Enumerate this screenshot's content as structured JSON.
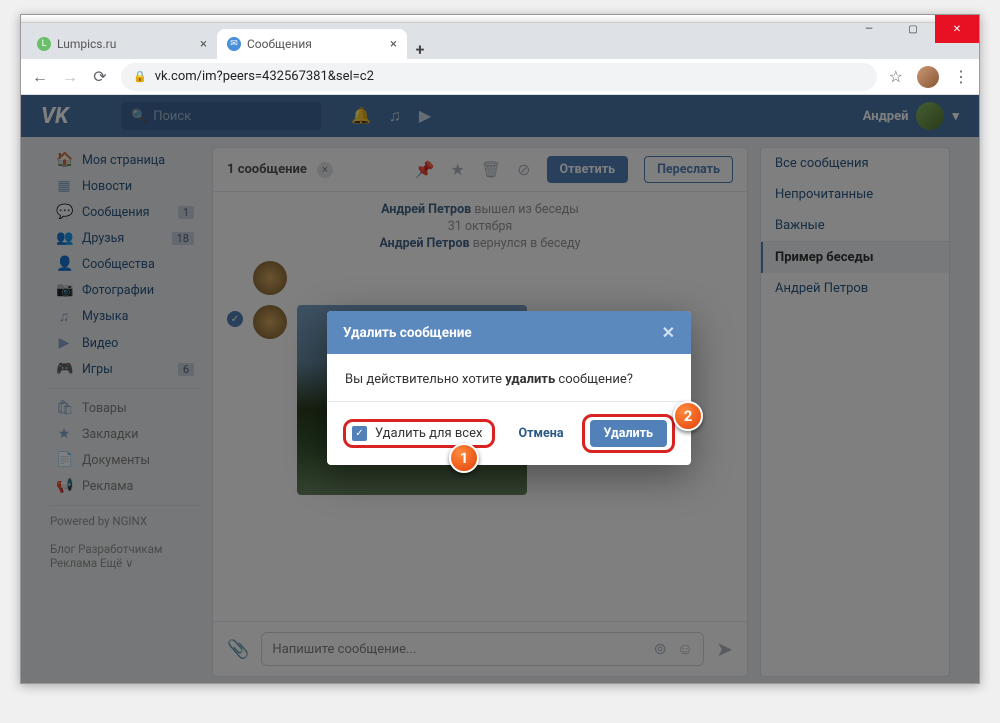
{
  "browser": {
    "tabs": [
      {
        "title": "Lumpics.ru",
        "active": false
      },
      {
        "title": "Сообщения",
        "active": true
      }
    ],
    "url": "vk.com/im?peers=432567381&sel=c2"
  },
  "vk": {
    "search_placeholder": "Поиск",
    "user_name": "Андрей",
    "nav": [
      {
        "icon": "🏠",
        "label": "Моя страница"
      },
      {
        "icon": "▦",
        "label": "Новости"
      },
      {
        "icon": "💬",
        "label": "Сообщения",
        "badge": "1"
      },
      {
        "icon": "👥",
        "label": "Друзья",
        "badge": "18"
      },
      {
        "icon": "👤",
        "label": "Сообщества"
      },
      {
        "icon": "📷",
        "label": "Фотографии"
      },
      {
        "icon": "♫",
        "label": "Музыка"
      },
      {
        "icon": "▶",
        "label": "Видео"
      },
      {
        "icon": "🎮",
        "label": "Игры",
        "badge": "6"
      }
    ],
    "nav2": [
      {
        "icon": "🛍",
        "label": "Товары"
      },
      {
        "icon": "★",
        "label": "Закладки"
      },
      {
        "icon": "📄",
        "label": "Документы"
      },
      {
        "icon": "📢",
        "label": "Реклама"
      }
    ],
    "nav_footer": {
      "powered": "Powered by NGINX",
      "links": "Блог  Разработчикам",
      "links2": "Реклама  Ещё ∨"
    },
    "chat": {
      "selected_count": "1 сообщение",
      "reply": "Ответить",
      "forward": "Переслать",
      "sys1_name": "Андрей Петров",
      "sys1_text": " вышел из беседы",
      "sys_date": "31 октября",
      "sys2_name": "Андрей Петров",
      "sys2_text": " вернулся в беседу",
      "input_placeholder": "Напишите сообщение..."
    },
    "right": {
      "items": [
        "Все сообщения",
        "Непрочитанные",
        "Важные"
      ],
      "sel": "Пример беседы",
      "person": "Андрей Петров"
    }
  },
  "modal": {
    "title": "Удалить сообщение",
    "body_pre": "Вы действительно хотите ",
    "body_bold": "удалить",
    "body_post": " сообщение?",
    "checkbox": "Удалить для всех",
    "cancel": "Отмена",
    "delete": "Удалить"
  },
  "markers": {
    "m1": "1",
    "m2": "2"
  }
}
